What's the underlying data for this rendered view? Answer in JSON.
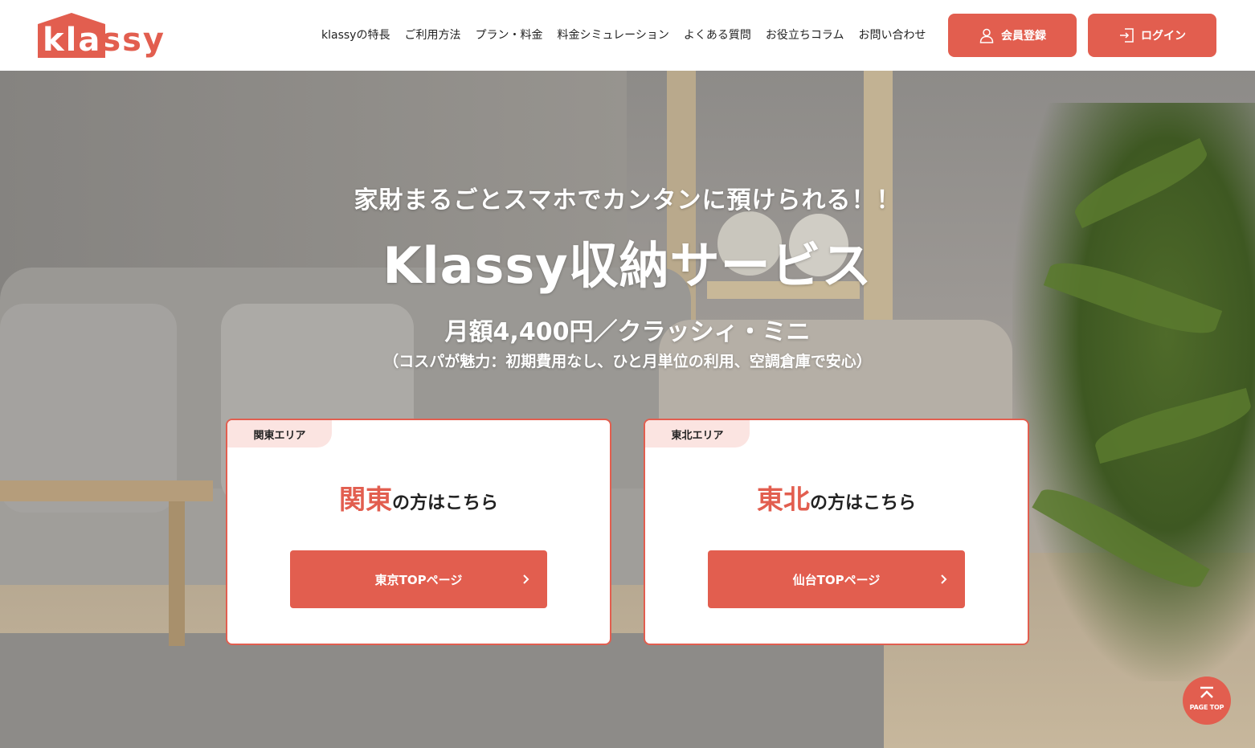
{
  "header": {
    "logo_text_main": "kla",
    "logo_text_tail": "ssy",
    "nav": [
      {
        "label": "klassyの特長"
      },
      {
        "label": "ご利用方法"
      },
      {
        "label": "プラン・料金"
      },
      {
        "label": "料金シミュレーション"
      },
      {
        "label": "よくある質問"
      },
      {
        "label": "お役立ちコラム"
      },
      {
        "label": "お問い合わせ"
      }
    ],
    "register_label": "会員登録",
    "login_label": "ログイン"
  },
  "hero": {
    "subtitle": "家財まるごとスマホでカンタンに預けられる！！",
    "title": "Klassy収納サービス",
    "price": "月額4,400円／クラッシィ・ミニ",
    "note": "（コスパが魅力：初期費用なし、ひと月単位の利用、空調倉庫で安心）"
  },
  "cards": [
    {
      "tag": "関東エリア",
      "heading_accent": "関東",
      "heading_rest": "の方はこちら",
      "button_label": "東京TOPページ"
    },
    {
      "tag": "東北エリア",
      "heading_accent": "東北",
      "heading_rest": "の方はこちら",
      "button_label": "仙台TOPページ"
    }
  ],
  "page_top_label": "PAGE TOP",
  "colors": {
    "accent": "#e25e4f",
    "tag_bg": "#fbe4e1"
  },
  "icons": {
    "register": "user-icon",
    "login": "login-icon",
    "card_button": "chevron-right-icon",
    "page_top": "arrow-up-icon"
  }
}
